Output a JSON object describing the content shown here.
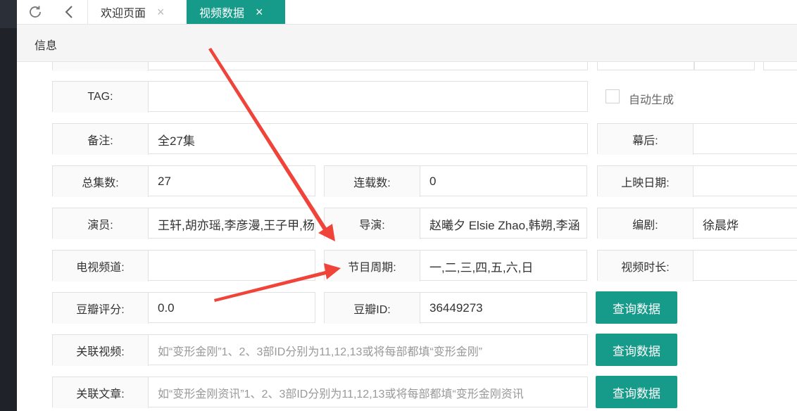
{
  "topbar": {
    "tabs": [
      {
        "label": "欢迎页面",
        "close": "×"
      },
      {
        "label": "视频数据",
        "close": "×"
      }
    ]
  },
  "infobar": {
    "title": "信息"
  },
  "form": {
    "tag": {
      "label": "TAG:",
      "value": ""
    },
    "auto_generate": {
      "label": "自动生成",
      "checked": false
    },
    "remark": {
      "label": "备注:",
      "value": "全27集"
    },
    "behind": {
      "label": "幕后:",
      "value": ""
    },
    "total_episodes": {
      "label": "总集数:",
      "value": "27"
    },
    "serial_count": {
      "label": "连载数:",
      "value": "0"
    },
    "release_date": {
      "label": "上映日期:",
      "value": ""
    },
    "actors": {
      "label": "演员:",
      "value": "王轩,胡亦瑶,李彦漫,王子甲,杨"
    },
    "director": {
      "label": "导演:",
      "value": "赵曦夕 Elsie Zhao,韩朔,李涵"
    },
    "writer": {
      "label": "编剧:",
      "value": "徐晨烨"
    },
    "tv_channel": {
      "label": "电视频道:",
      "value": ""
    },
    "schedule": {
      "label": "节目周期:",
      "value": "一,二,三,四,五,六,日"
    },
    "duration": {
      "label": "视频时长:",
      "value": ""
    },
    "douban_score": {
      "label": "豆瓣评分:",
      "value": "0.0"
    },
    "douban_id": {
      "label": "豆瓣ID:",
      "value": "36449273"
    },
    "related_video": {
      "label": "关联视频:",
      "placeholder": "如“变形金刚”1、2、3部ID分别为11,12,13或将每部都填“变形金刚”"
    },
    "related_article": {
      "label": "关联文章:",
      "placeholder": "如“变形金刚资讯”1、2、3部ID分别为11,12,13或将每部都填“变形金刚资讯"
    },
    "query_button_label": "查询数据"
  },
  "colors": {
    "accent": "#169b8a",
    "annotation_arrow": "#f0433a"
  }
}
